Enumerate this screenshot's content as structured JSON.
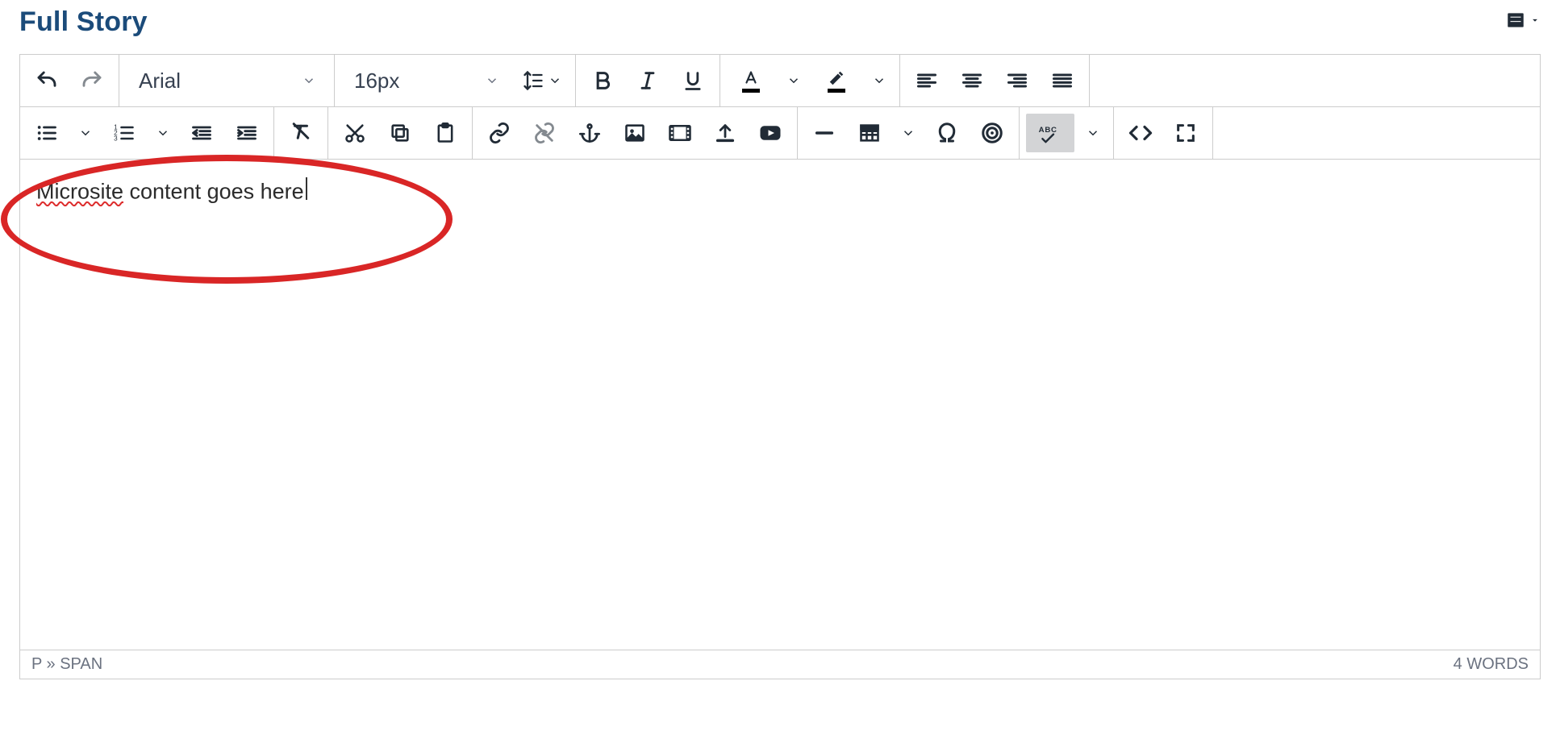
{
  "header": {
    "title": "Full Story"
  },
  "toolbar": {
    "font_family": "Arial",
    "font_size": "16px"
  },
  "editor": {
    "content_word1": "Microsite",
    "content_rest": " content goes here"
  },
  "statusbar": {
    "path": "P » SPAN",
    "wordcount": "4 WORDS"
  }
}
